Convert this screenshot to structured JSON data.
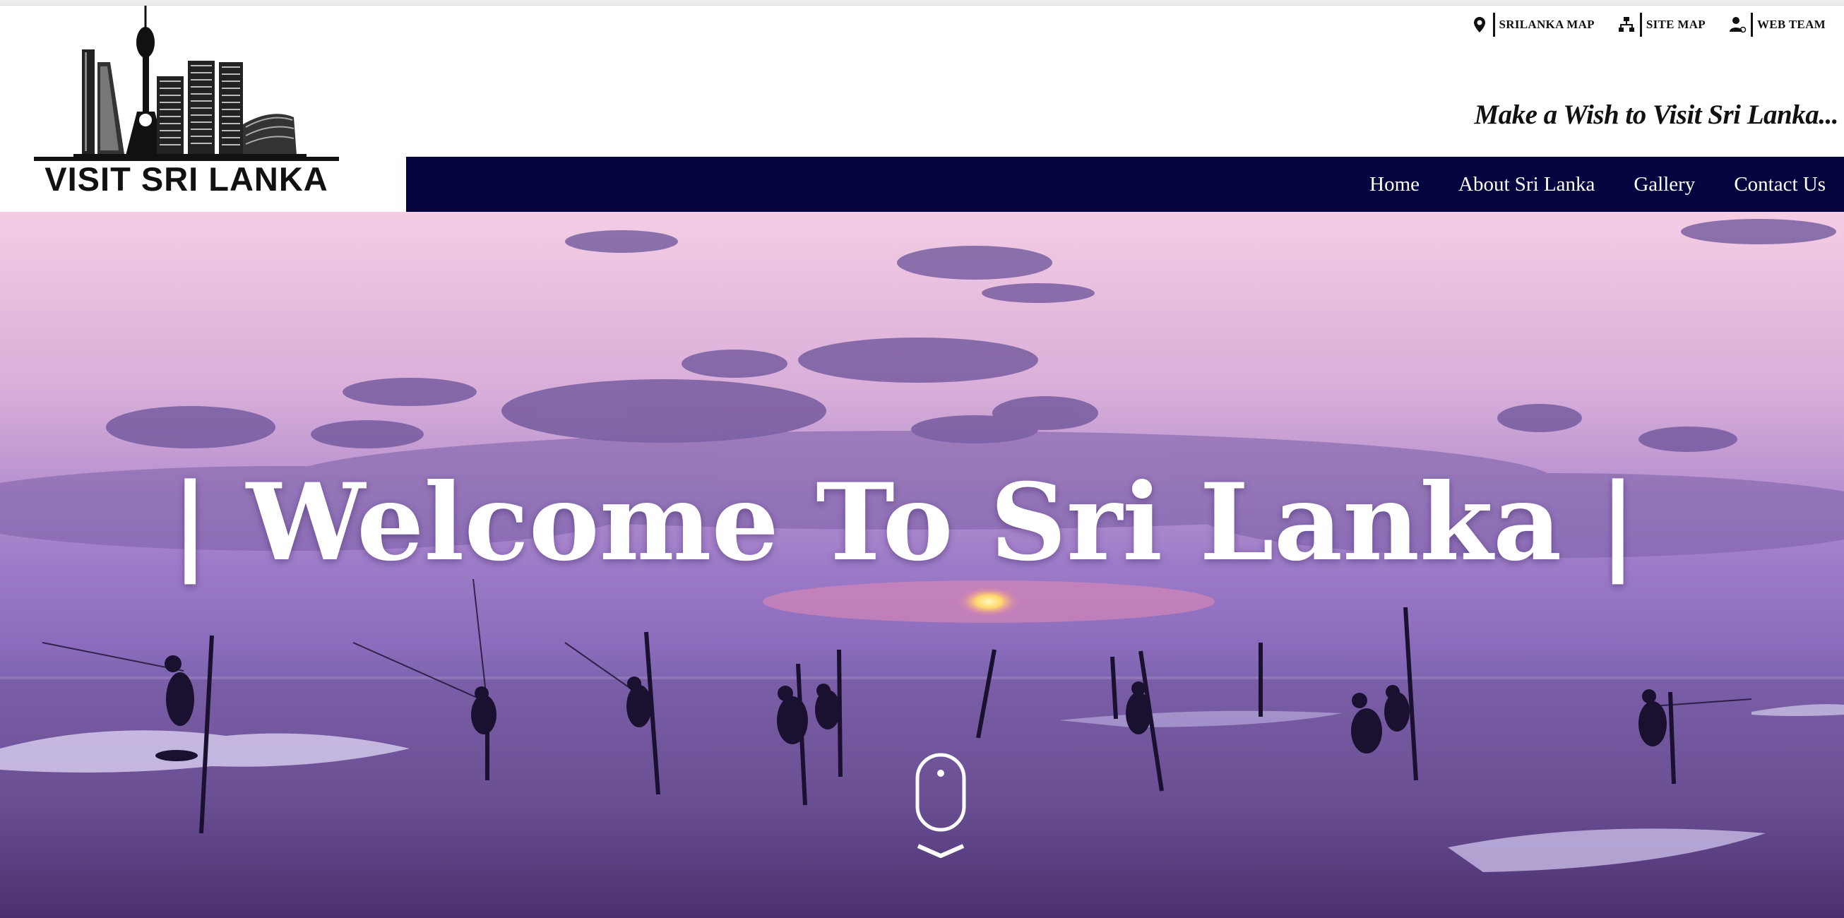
{
  "logo": {
    "text": "VISIT SRI LANKA"
  },
  "utility_links": [
    {
      "label": "SRILANKA MAP",
      "icon": "map-pin-icon"
    },
    {
      "label": "SITE MAP",
      "icon": "sitemap-icon"
    },
    {
      "label": "WEB TEAM",
      "icon": "team-user-icon"
    }
  ],
  "tagline": "Make a Wish to Visit Sri Lanka...",
  "nav": {
    "items": [
      {
        "label": "Home"
      },
      {
        "label": "About Sri Lanka"
      },
      {
        "label": "Gallery"
      },
      {
        "label": "Contact Us"
      }
    ]
  },
  "hero": {
    "title": "| Welcome To Sri Lanka |",
    "scroll_icon": "mouse-scroll-icon"
  },
  "colors": {
    "nav_bg": "#050640",
    "nav_text": "#ffffff",
    "sky_top": "#f0c8e4",
    "sky_mid": "#b290d6",
    "sea": "#6a4f96"
  }
}
